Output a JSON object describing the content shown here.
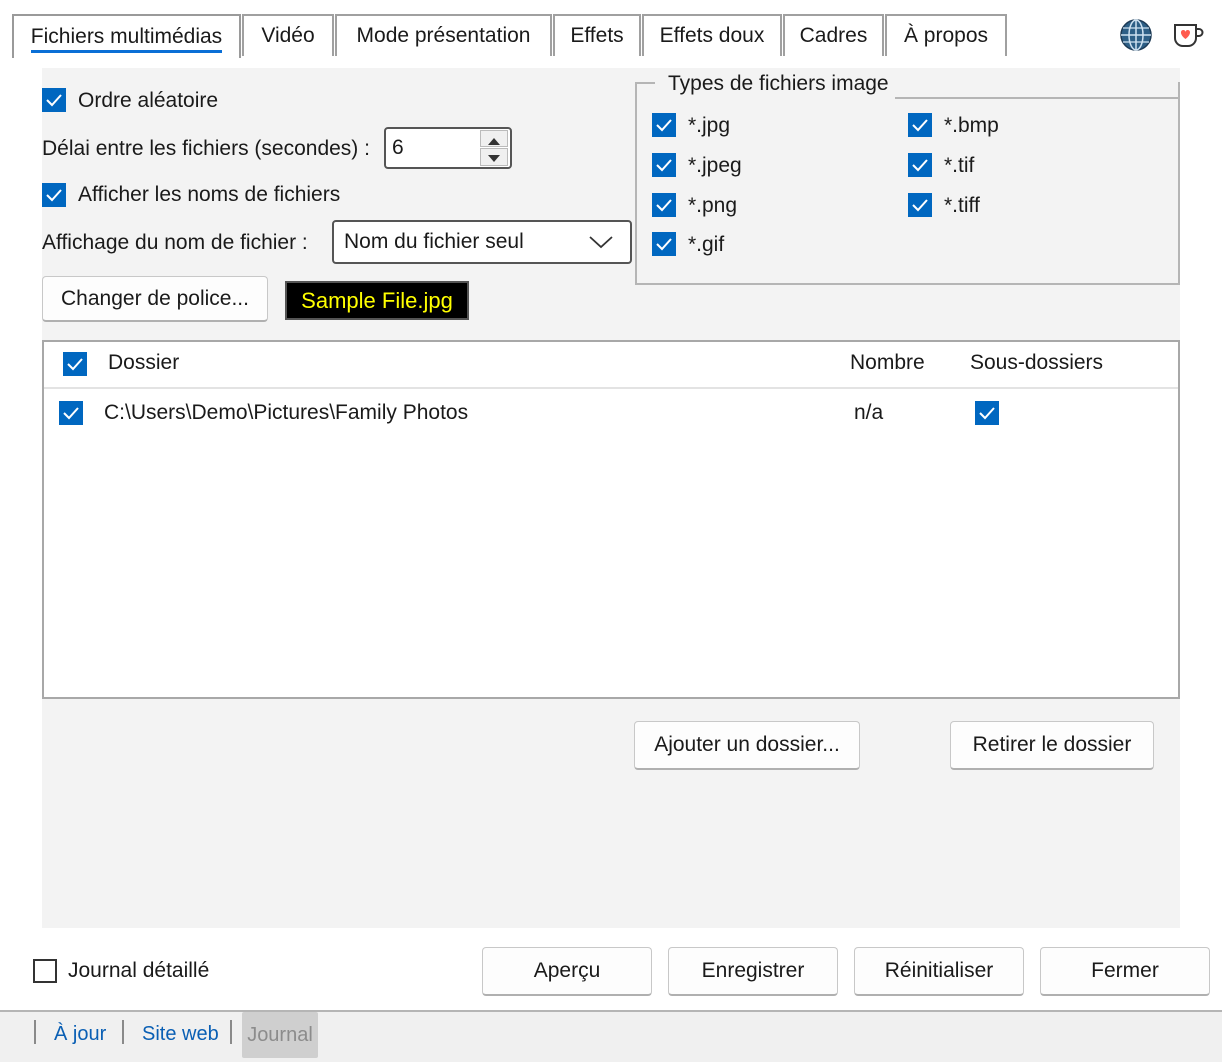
{
  "tabs": [
    "Fichiers multimédias",
    "Vidéo",
    "Mode présentation",
    "Effets",
    "Effets doux",
    "Cadres",
    "À propos"
  ],
  "options": {
    "random_order": {
      "label": "Ordre aléatoire",
      "checked": true
    },
    "delay_label": "Délai entre les fichiers (secondes) :",
    "delay_value": "6",
    "show_names": {
      "label": "Afficher les noms de fichiers",
      "checked": true
    },
    "name_display_label": "Affichage du nom de fichier :",
    "name_display_value": "Nom du fichier seul",
    "font_button": "Changer de police...",
    "sample_text": "Sample File.jpg"
  },
  "file_types": {
    "title": "Types de fichiers image",
    "items": [
      {
        "label": "*.jpg",
        "checked": true
      },
      {
        "label": "*.jpeg",
        "checked": true
      },
      {
        "label": "*.png",
        "checked": true
      },
      {
        "label": "*.gif",
        "checked": true
      },
      {
        "label": "*.bmp",
        "checked": true
      },
      {
        "label": "*.tif",
        "checked": true
      },
      {
        "label": "*.tiff",
        "checked": true
      }
    ]
  },
  "folders": {
    "columns": [
      "Dossier",
      "Nombre",
      "Sous-dossiers"
    ],
    "rows": [
      {
        "path": "C:\\Users\\Demo\\Pictures\\Family Photos",
        "count": "n/a",
        "subfolders": true,
        "checked": true
      }
    ],
    "add_button": "Ajouter un dossier...",
    "remove_button": "Retirer le dossier"
  },
  "footer": {
    "verbose_log": {
      "label": "Journal détaillé",
      "checked": false
    },
    "preview": "Aperçu",
    "save": "Enregistrer",
    "reset": "Réinitialiser",
    "close": "Fermer"
  },
  "statusbar": {
    "update": "À jour",
    "website": "Site web",
    "journal": "Journal"
  },
  "colors": {
    "accent": "#0067c0",
    "sample_bg": "#000000",
    "sample_fg": "#ffff00",
    "link": "#0a5fb4"
  }
}
